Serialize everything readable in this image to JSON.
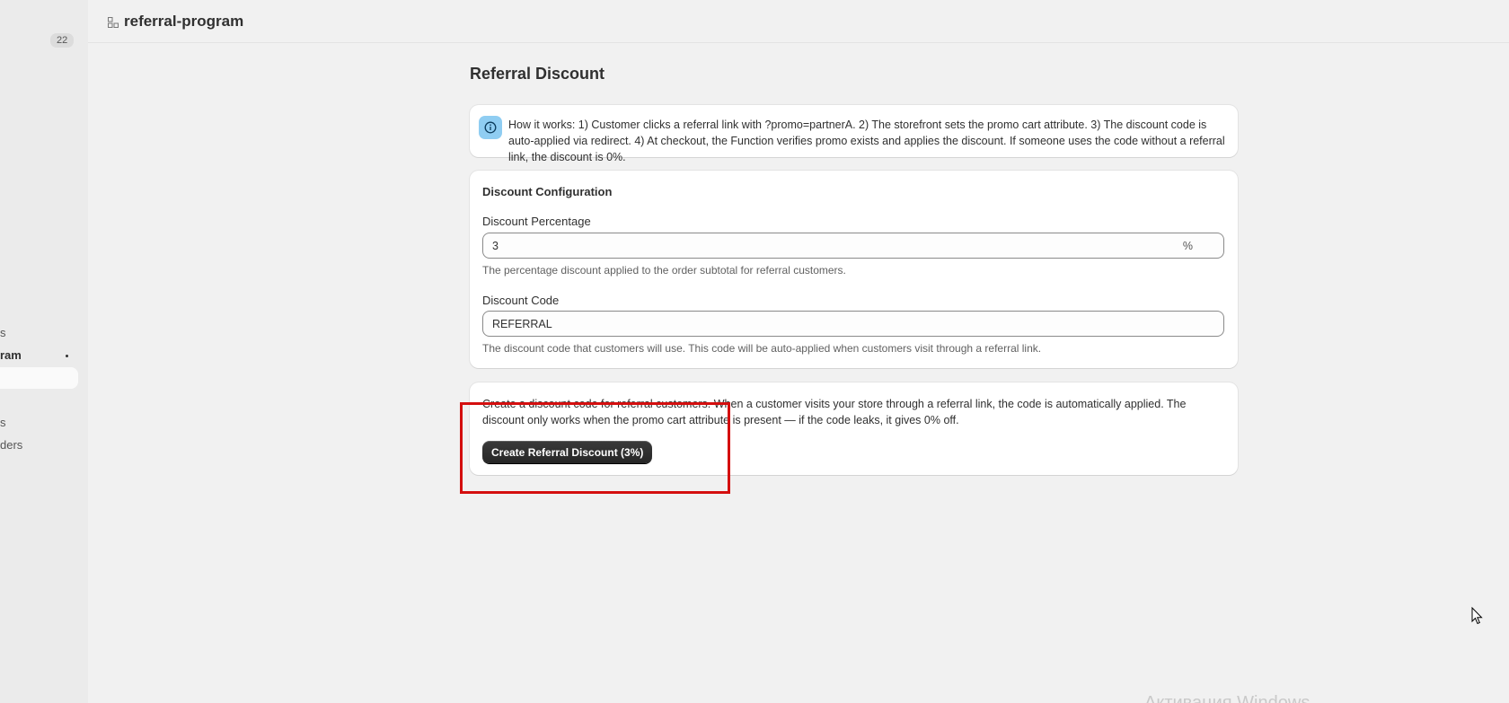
{
  "sidebar": {
    "badge": "22",
    "items": [
      "s",
      "ram",
      "s",
      "ders"
    ]
  },
  "header": {
    "app_name": "referral-program"
  },
  "page": {
    "title": "Referral Discount"
  },
  "banner": {
    "icon": "info-icon",
    "text": "How it works: 1) Customer clicks a referral link with ?promo=partnerA. 2) The storefront sets the promo cart attribute. 3) The discount code is auto-applied via redirect. 4) At checkout, the Function verifies promo exists and applies the discount. If someone uses the code without a referral link, the discount is 0%."
  },
  "config": {
    "title": "Discount Configuration",
    "percentage": {
      "label": "Discount Percentage",
      "value": "3",
      "suffix": "%",
      "help": "The percentage discount applied to the order subtotal for referral customers."
    },
    "code": {
      "label": "Discount Code",
      "value": "REFERRAL",
      "help": "The discount code that customers will use. This code will be auto-applied when customers visit through a referral link."
    }
  },
  "create": {
    "text": "Create a discount code for referral customers. When a customer visits your store through a referral link, the code is automatically applied. The discount only works when the promo cart attribute is present — if the code leaks, it gives 0% off.",
    "button_label": "Create Referral Discount (3%)"
  },
  "watermark": "Активация Windows",
  "colors": {
    "highlight": "#d40f0f",
    "primary_button": "#303030",
    "info": "#8fcdf2"
  }
}
